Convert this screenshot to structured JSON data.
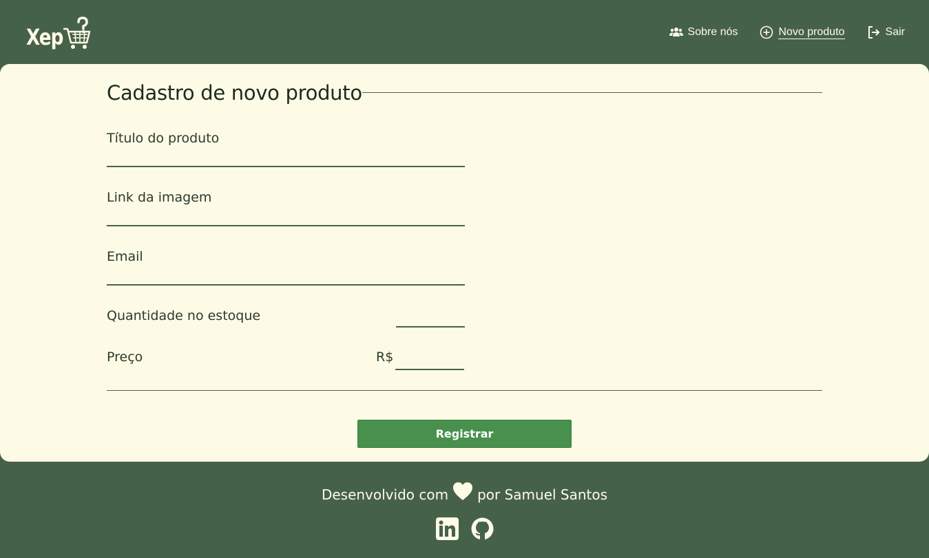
{
  "header": {
    "logo_text": "Xep",
    "nav": [
      {
        "label": "Sobre nós",
        "icon": "users-icon"
      },
      {
        "label": "Novo produto",
        "icon": "plus-circle-icon"
      },
      {
        "label": "Sair",
        "icon": "logout-icon"
      }
    ]
  },
  "form": {
    "title": "Cadastro de novo produto",
    "fields": {
      "title": {
        "label": "Título do produto",
        "value": ""
      },
      "image": {
        "label": "Link da imagem",
        "value": ""
      },
      "email": {
        "label": "Email",
        "value": ""
      },
      "stock": {
        "label": "Quantidade no estoque",
        "value": ""
      },
      "price": {
        "label": "Preço",
        "currency": "R$",
        "value": ""
      }
    },
    "submit_label": "Registrar"
  },
  "footer": {
    "credit_before": "Desenvolvido com",
    "credit_after": "por Samuel Santos",
    "socials": [
      "linkedin-icon",
      "github-icon"
    ]
  },
  "colors": {
    "background": "#466149",
    "card": "#fdfbe6",
    "button": "#48904d",
    "text_light": "#fdfbe6"
  }
}
